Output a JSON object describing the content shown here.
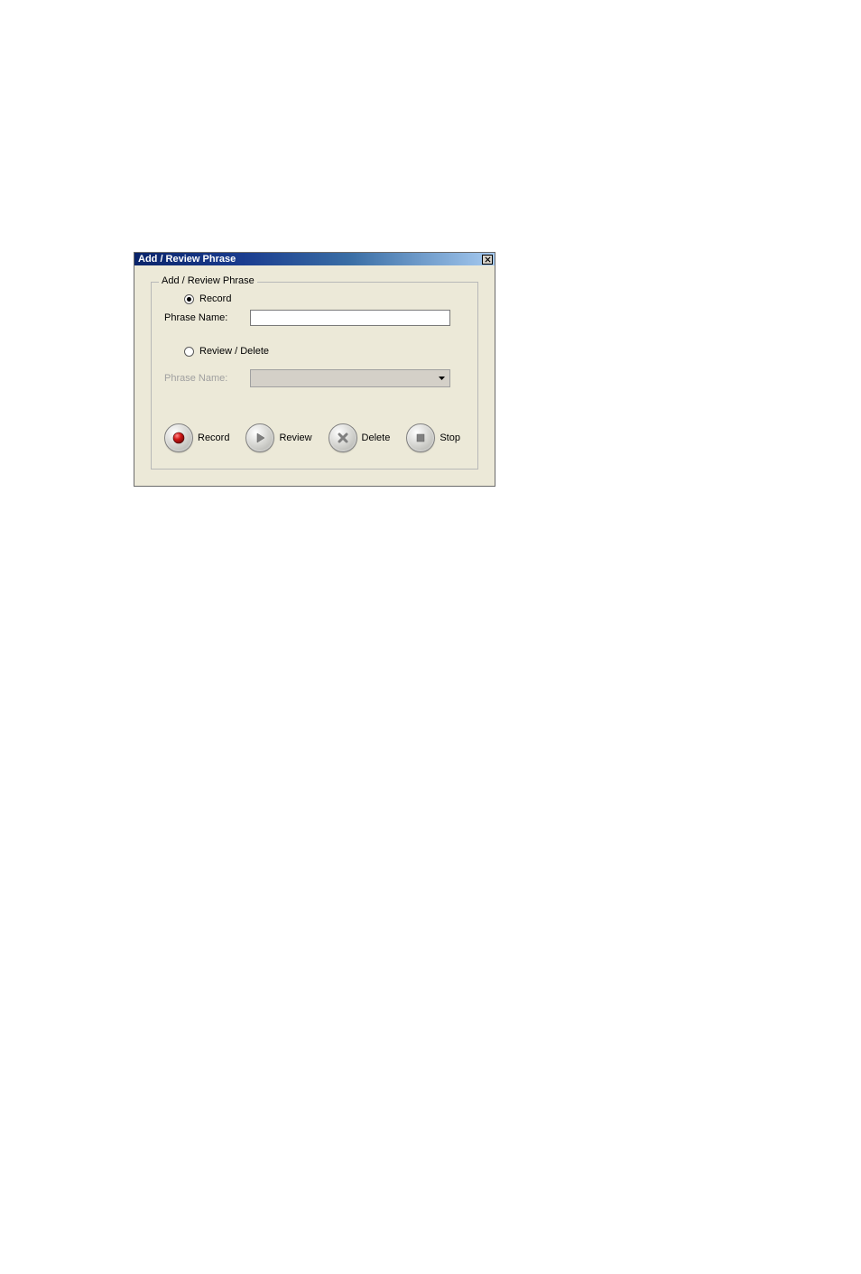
{
  "window": {
    "title": "Add / Review Phrase"
  },
  "groupbox": {
    "legend": "Add / Review Phrase",
    "record_radio_label": "Record",
    "record_phrase_name_label": "Phrase Name:",
    "record_phrase_name_value": "",
    "review_radio_label": "Review / Delete",
    "review_phrase_name_label": "Phrase Name:",
    "review_phrase_name_value": ""
  },
  "buttons": {
    "record": "Record",
    "review": "Review",
    "delete": "Delete",
    "stop": "Stop"
  }
}
